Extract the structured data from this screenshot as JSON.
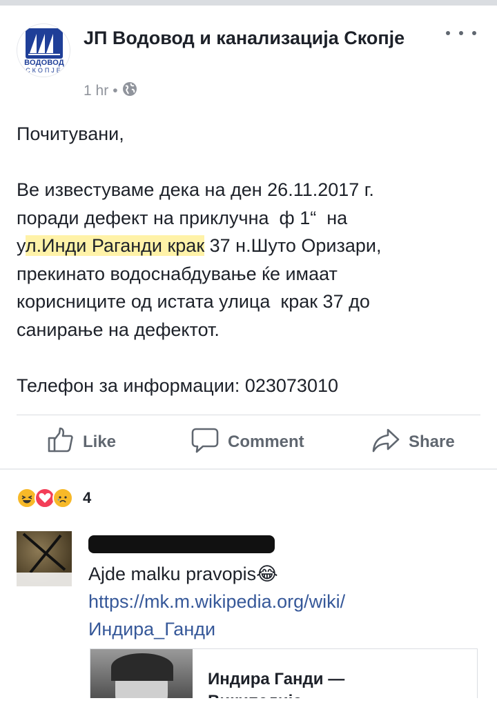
{
  "post": {
    "page_name": "ЈП Водовод  и канализација Скопје",
    "avatar": {
      "logo_top": "ВОДОВОД",
      "logo_bottom": "СКОПЈЕ",
      "brand_color": "#1f3f98"
    },
    "time": "1 hr",
    "audience_icon": "globe-icon",
    "greeting": "Почитувани,",
    "body_line1": "Ве известуваме дека на ден 26.11.2017 г.",
    "body_line2": "поради дефект на приклучна  ф 1“  на",
    "body_line3_pre": "у",
    "body_line3_hl": "л.Инди Раганди крак",
    "body_line3_post": " 37 н.Шуто Оризари,",
    "body_line4": "прекинато водоснабдување ќе имаат",
    "body_line5": "корисниците од истата улица  крак 37 до",
    "body_line6": "санирање на дефектот.",
    "phone_line": "Телефон за информации: 023073010",
    "highlight_color": "#fff2a8"
  },
  "actions": {
    "like_label": "Like",
    "comment_label": "Comment",
    "share_label": "Share"
  },
  "reactions": {
    "icons": [
      "haha-icon",
      "love-icon",
      "sad-icon"
    ],
    "count": "4"
  },
  "comment": {
    "text": "Ajde malku pravopis😂",
    "link_line1": "https://mk.m.wikipedia.org/wiki/",
    "link_line2": "Индира_Ганди",
    "link_color": "#365899"
  },
  "link_card": {
    "title_line1": "Индира Ганди —",
    "title_line2": "Википедија"
  }
}
